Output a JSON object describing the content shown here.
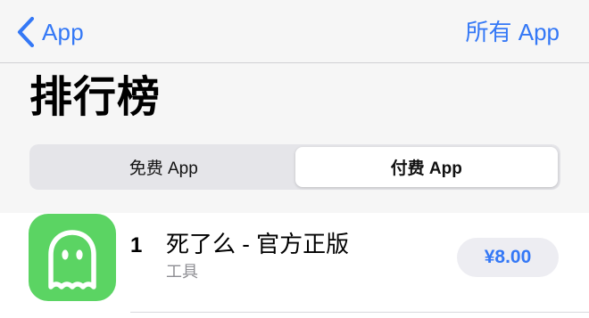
{
  "nav": {
    "back_label": "App",
    "all_apps_label": "所有 App"
  },
  "page": {
    "title": "排行榜"
  },
  "segments": [
    {
      "label": "免费 App",
      "selected": false
    },
    {
      "label": "付费 App",
      "selected": true
    }
  ],
  "apps": [
    {
      "rank": "1",
      "name": "死了么 - 官方正版",
      "category": "工具",
      "price": "¥8.00",
      "icon": "ghost-icon",
      "icon_color": "#5bd463"
    }
  ],
  "colors": {
    "accent": "#3478f6",
    "header_background": "#f6f6f6",
    "segment_track": "#e5e5e9",
    "price_pill": "#ededf2",
    "secondary_text": "#8e8e93"
  }
}
